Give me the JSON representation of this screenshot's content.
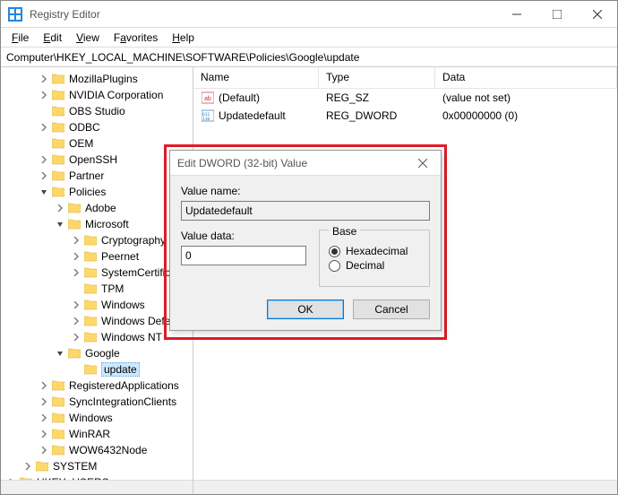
{
  "window": {
    "title": "Registry Editor",
    "min_label": "Minimize",
    "max_label": "Maximize",
    "close_label": "Close"
  },
  "menu": {
    "file": "File",
    "edit": "Edit",
    "view": "View",
    "favorites": "Favorites",
    "help": "Help"
  },
  "address": {
    "label": "",
    "path": "Computer\\HKEY_LOCAL_MACHINE\\SOFTWARE\\Policies\\Google\\update"
  },
  "tree": {
    "items": [
      {
        "indent": 2,
        "exp": "collapsed",
        "label": "MozillaPlugins",
        "dotted": true
      },
      {
        "indent": 2,
        "exp": "collapsed",
        "label": "NVIDIA Corporation",
        "dotted": true
      },
      {
        "indent": 2,
        "exp": "none",
        "label": "OBS Studio",
        "dotted": true
      },
      {
        "indent": 2,
        "exp": "collapsed",
        "label": "ODBC",
        "dotted": true
      },
      {
        "indent": 2,
        "exp": "none",
        "label": "OEM",
        "dotted": true
      },
      {
        "indent": 2,
        "exp": "collapsed",
        "label": "OpenSSH",
        "dotted": true
      },
      {
        "indent": 2,
        "exp": "collapsed",
        "label": "Partner",
        "dotted": true
      },
      {
        "indent": 2,
        "exp": "expanded",
        "label": "Policies",
        "dotted": false
      },
      {
        "indent": 3,
        "exp": "collapsed",
        "label": "Adobe",
        "dotted": true
      },
      {
        "indent": 3,
        "exp": "expanded",
        "label": "Microsoft",
        "dotted": false
      },
      {
        "indent": 4,
        "exp": "collapsed",
        "label": "Cryptography",
        "dotted": true
      },
      {
        "indent": 4,
        "exp": "collapsed",
        "label": "Peernet",
        "dotted": true
      },
      {
        "indent": 4,
        "exp": "collapsed",
        "label": "SystemCertificates",
        "dotted": true
      },
      {
        "indent": 4,
        "exp": "none",
        "label": "TPM",
        "dotted": true
      },
      {
        "indent": 4,
        "exp": "collapsed",
        "label": "Windows",
        "dotted": true
      },
      {
        "indent": 4,
        "exp": "collapsed",
        "label": "Windows Defender",
        "dotted": true
      },
      {
        "indent": 4,
        "exp": "collapsed",
        "label": "Windows NT",
        "dotted": true
      },
      {
        "indent": 3,
        "exp": "expanded",
        "label": "Google",
        "dotted": false
      },
      {
        "indent": 4,
        "exp": "none",
        "label": "update",
        "selected": true
      },
      {
        "indent": 2,
        "exp": "collapsed",
        "label": "RegisteredApplications",
        "dotted": true
      },
      {
        "indent": 2,
        "exp": "collapsed",
        "label": "SyncIntegrationClients",
        "dotted": true
      },
      {
        "indent": 2,
        "exp": "collapsed",
        "label": "Windows",
        "dotted": true
      },
      {
        "indent": 2,
        "exp": "collapsed",
        "label": "WinRAR",
        "dotted": true
      },
      {
        "indent": 2,
        "exp": "collapsed",
        "label": "WOW6432Node",
        "dotted": true
      },
      {
        "indent": 1,
        "exp": "collapsed",
        "label": "SYSTEM",
        "dotted": true
      },
      {
        "indent": 0,
        "exp": "collapsed",
        "label": "HKEY_USERS",
        "dotted": true
      }
    ]
  },
  "list": {
    "columns": {
      "name": "Name",
      "type": "Type",
      "data": "Data"
    },
    "rows": [
      {
        "icon": "string",
        "name": "(Default)",
        "type": "REG_SZ",
        "data": "(value not set)"
      },
      {
        "icon": "binary",
        "name": "Updatedefault",
        "type": "REG_DWORD",
        "data": "0x00000000 (0)"
      }
    ]
  },
  "dialog": {
    "title": "Edit DWORD (32-bit) Value",
    "value_name_label": "Value name:",
    "value_name": "Updatedefault",
    "value_data_label": "Value data:",
    "value_data": "0",
    "base_label": "Base",
    "hex_label": "Hexadecimal",
    "dec_label": "Decimal",
    "base_selected": "hex",
    "ok_label": "OK",
    "cancel_label": "Cancel"
  }
}
